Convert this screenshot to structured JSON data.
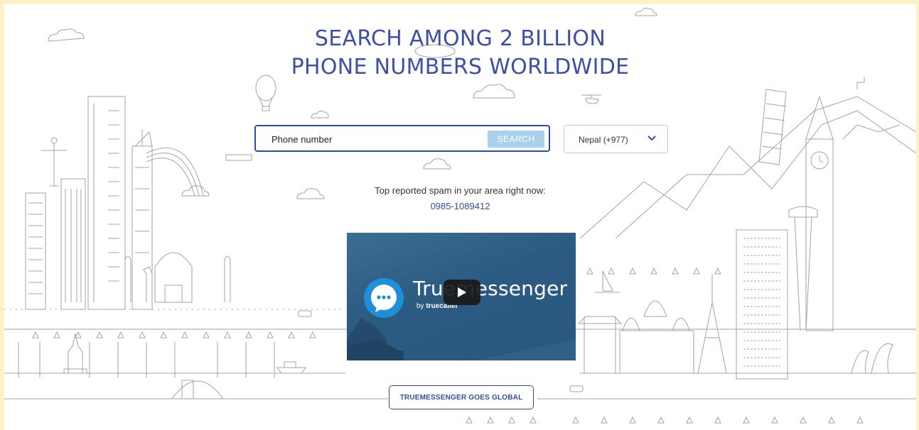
{
  "hero": {
    "headline_line1": "SEARCH AMONG 2 BILLION",
    "headline_line2": "PHONE NUMBERS WORLDWIDE"
  },
  "search": {
    "placeholder": "Phone number",
    "value": "",
    "button_label": "SEARCH",
    "country_selected": "Nepal (+977)"
  },
  "spam": {
    "label": "Top reported spam in your area right now:",
    "number": "0985-1089412"
  },
  "video": {
    "title": "Truemessenger",
    "byline_prefix": "by",
    "byline_brand": "truecaller",
    "play_icon": "play-icon"
  },
  "cta": {
    "label": "TRUEMESSENGER GOES GLOBAL"
  },
  "colors": {
    "page_border": "#fbf3c6",
    "brand_blue": "#2e4fa0",
    "headline_blue": "#3d4fa8",
    "search_button": "#a9d1ee",
    "line_art": "#9a9a9a",
    "video_bg": "#2c5b82"
  }
}
